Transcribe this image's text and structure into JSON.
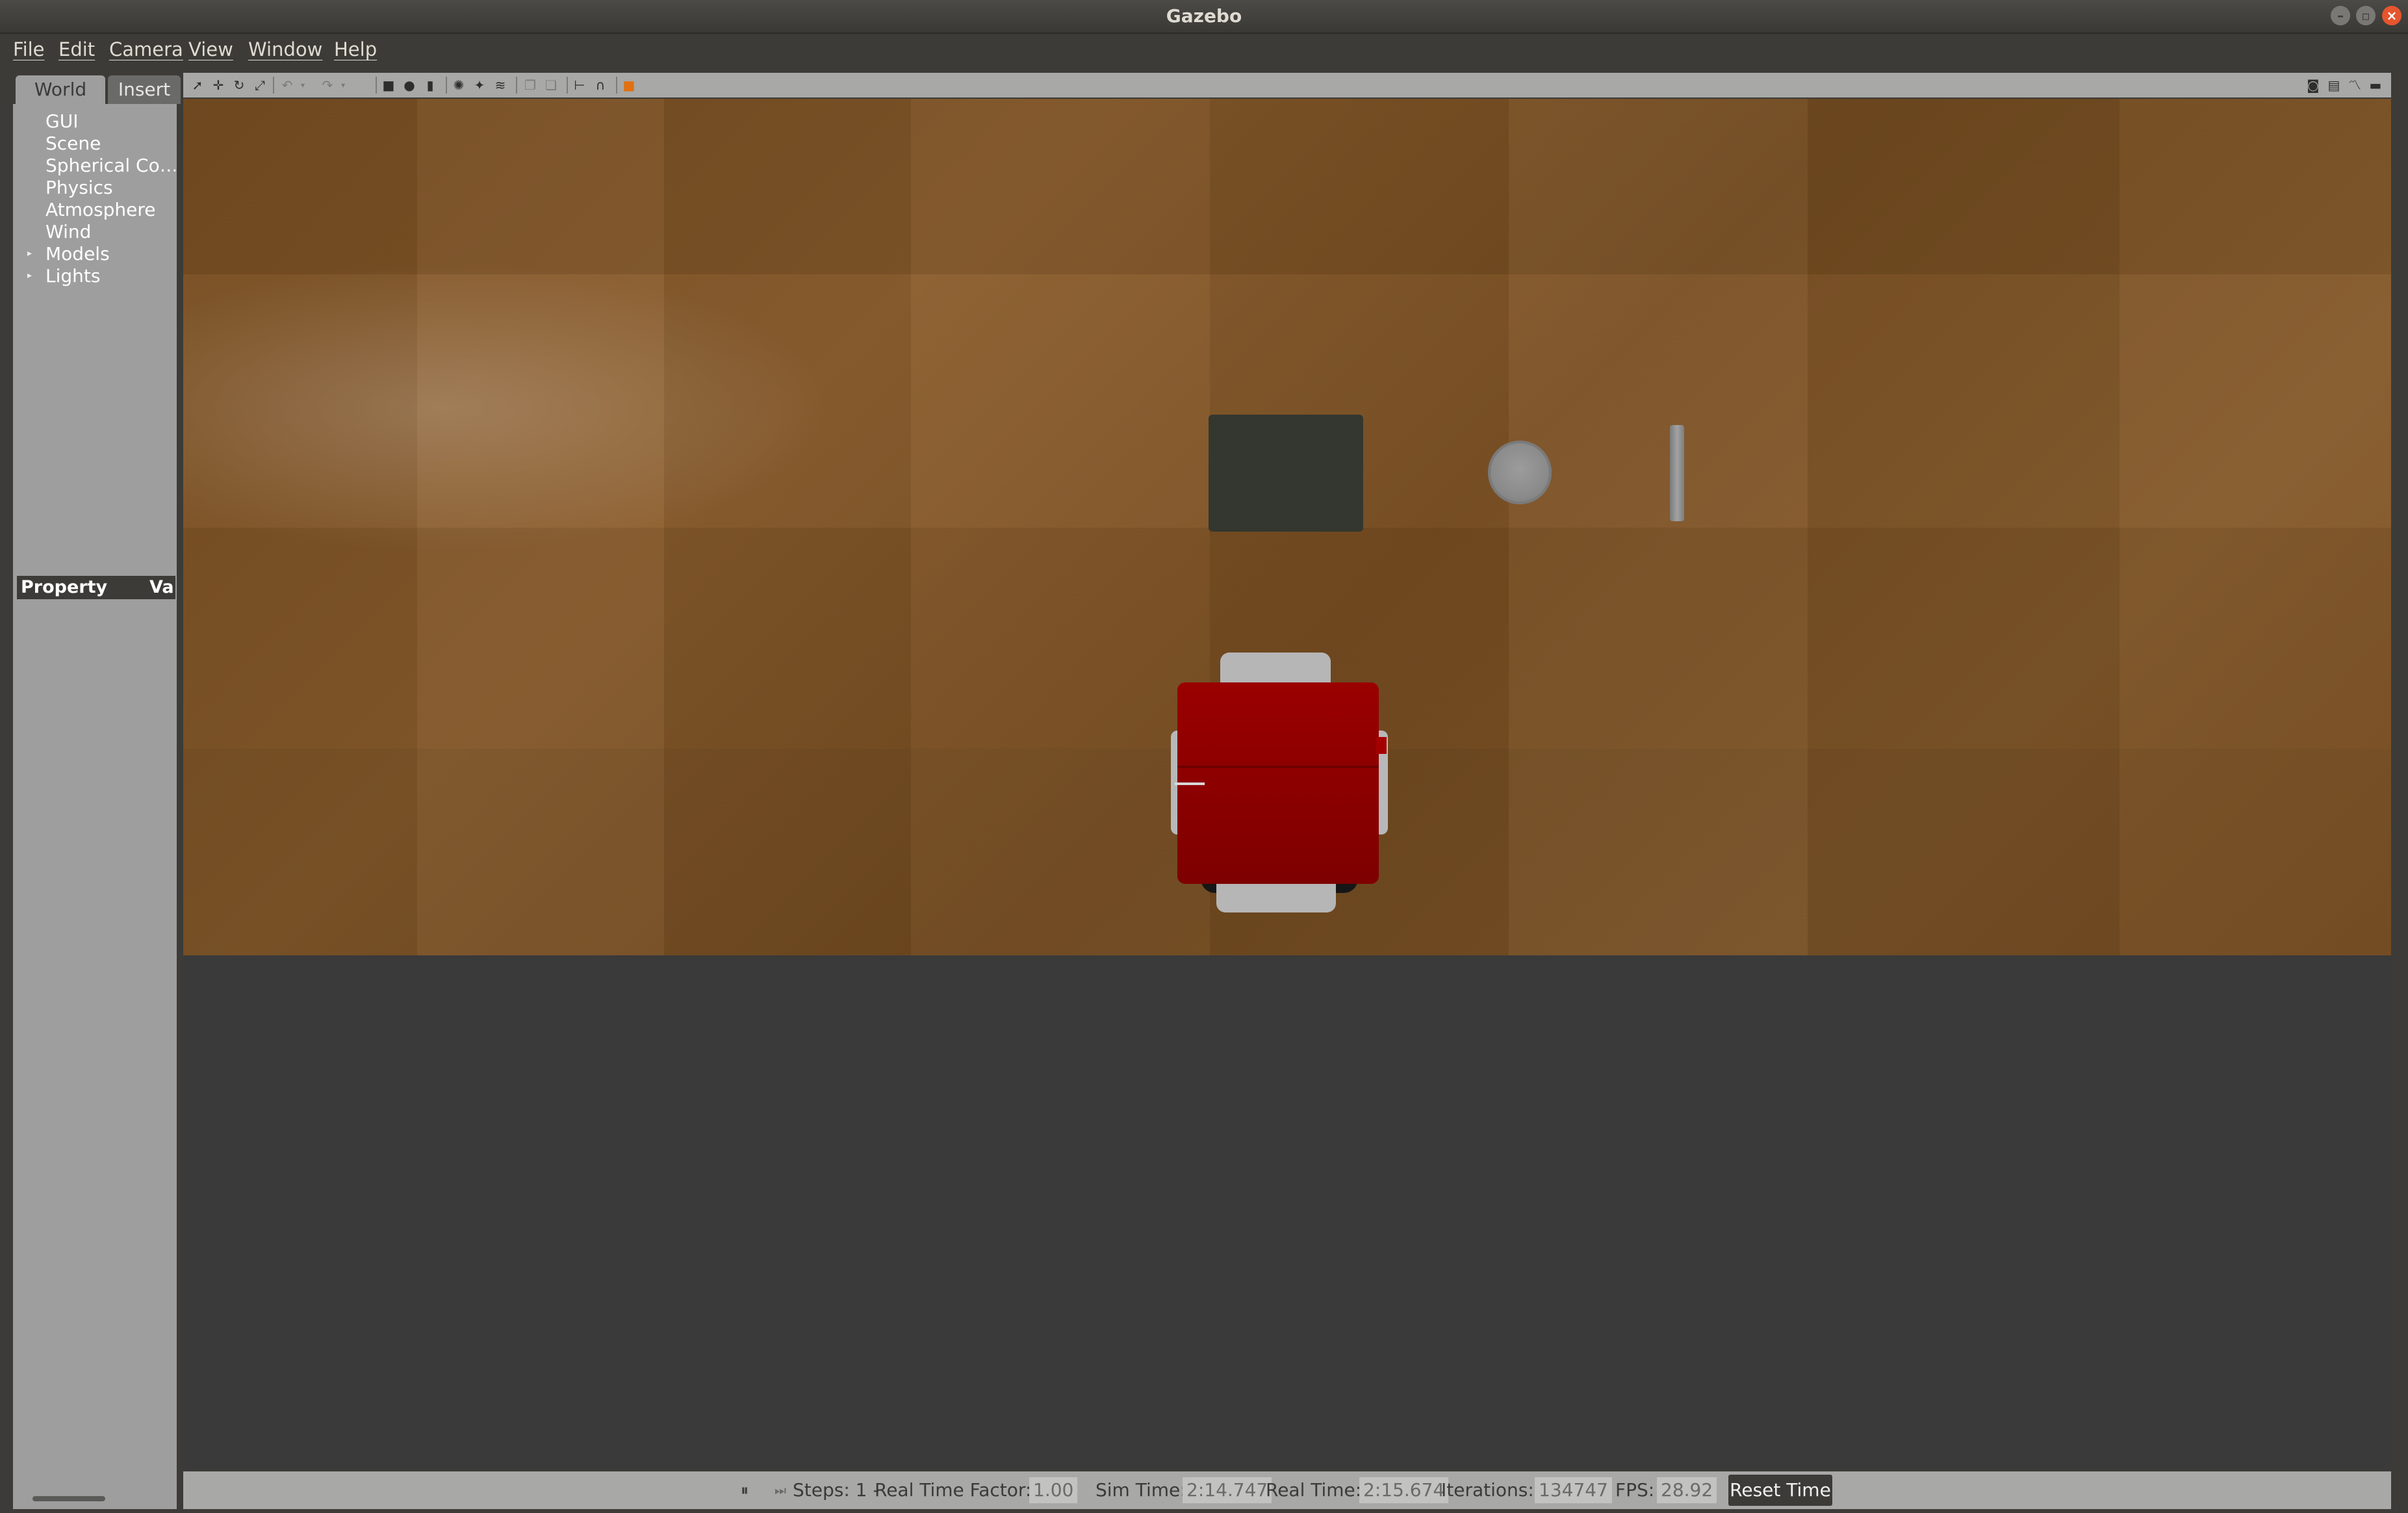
{
  "window": {
    "title": "Gazebo"
  },
  "menu": [
    "File",
    "Edit",
    "Camera",
    "View",
    "Window",
    "Help"
  ],
  "left_panel": {
    "tabs": [
      "World",
      "Insert"
    ],
    "tree": [
      {
        "label": "GUI",
        "expandable": false
      },
      {
        "label": "Scene",
        "expandable": false
      },
      {
        "label": "Spherical Co…",
        "expandable": false
      },
      {
        "label": "Physics",
        "expandable": false
      },
      {
        "label": "Atmosphere",
        "expandable": false
      },
      {
        "label": "Wind",
        "expandable": false
      },
      {
        "label": "Models",
        "expandable": true
      },
      {
        "label": "Lights",
        "expandable": true
      }
    ],
    "property_header": {
      "property": "Property",
      "value": "Va"
    }
  },
  "toolbar": {
    "icons": [
      "select-icon",
      "translate-icon",
      "rotate-icon",
      "scale-icon",
      "undo-icon",
      "undo-history-icon",
      "redo-icon",
      "redo-history-icon",
      "box-icon",
      "sphere-icon",
      "cylinder-icon",
      "point-light-icon",
      "spot-light-icon",
      "directional-light-icon",
      "copy-icon",
      "paste-icon",
      "align-icon",
      "snap-icon",
      "change-view-icon"
    ],
    "right_icons": [
      "screenshot-icon",
      "log-icon",
      "plot-icon",
      "video-icon"
    ]
  },
  "status": {
    "steps_label": "Steps: 1 -",
    "rtf_label": "Real Time Factor:",
    "rtf_value": "1.00",
    "sim_time_label": "Sim Time:",
    "sim_time_value": "2:14.747",
    "real_time_label": "Real Time:",
    "real_time_value": "2:15.674",
    "iterations_label": "Iterations:",
    "iterations_value": "134747",
    "fps_label": "FPS:",
    "fps_value": "28.92",
    "reset_label": "Reset Time"
  },
  "colors": {
    "robot_body": "#8b0000",
    "floor": "#7e5224",
    "panel": "#9e9e9e"
  }
}
